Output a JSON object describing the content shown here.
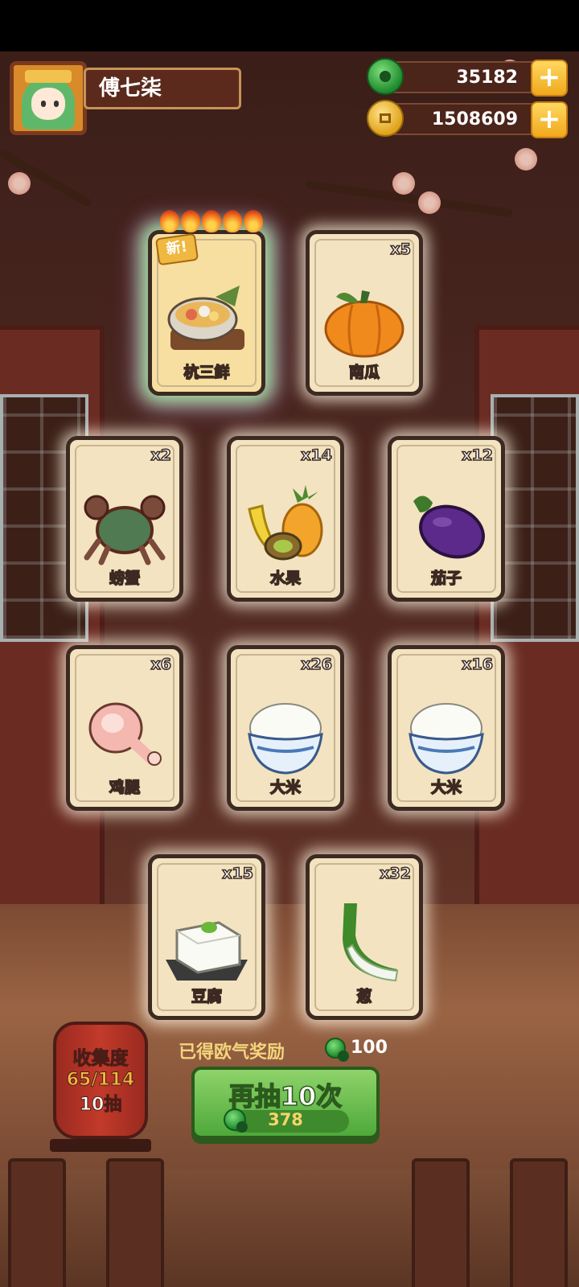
{
  "player": {
    "name": "傅七柒"
  },
  "currencies": {
    "jade": {
      "value": "35182",
      "icon": "jade-coin-icon"
    },
    "gold": {
      "value": "1508609",
      "icon": "gold-coin-icon"
    },
    "plus_label": "+"
  },
  "cards": [
    {
      "label": "杭三鲜",
      "count": "",
      "badge": "新!",
      "flames": 5,
      "icon": "hangzhou-stew-icon"
    },
    {
      "label": "南瓜",
      "count": "x5",
      "icon": "pumpkin-icon"
    },
    {
      "label": "螃蟹",
      "count": "x2",
      "icon": "crab-icon"
    },
    {
      "label": "水果",
      "count": "x14",
      "icon": "fruit-icon"
    },
    {
      "label": "茄子",
      "count": "x12",
      "icon": "eggplant-icon"
    },
    {
      "label": "鸡腿",
      "count": "x6",
      "icon": "drumstick-icon"
    },
    {
      "label": "大米",
      "count": "x26",
      "icon": "rice-bowl-icon"
    },
    {
      "label": "大米",
      "count": "x16",
      "icon": "rice-bowl-icon"
    },
    {
      "label": "豆腐",
      "count": "x15",
      "icon": "tofu-icon"
    },
    {
      "label": "葱",
      "count": "x32",
      "icon": "scallion-icon"
    }
  ],
  "collection": {
    "title": "收集度",
    "progress": "65/114",
    "draws": "10抽"
  },
  "reward": {
    "label": "已得欧气奖励",
    "value": "100"
  },
  "draw_button": {
    "label": "再抽10次",
    "cost": "378"
  },
  "colors": {
    "jade": "#2fae3e",
    "gold": "#f0a81c",
    "button_green": "#6cc04f"
  }
}
